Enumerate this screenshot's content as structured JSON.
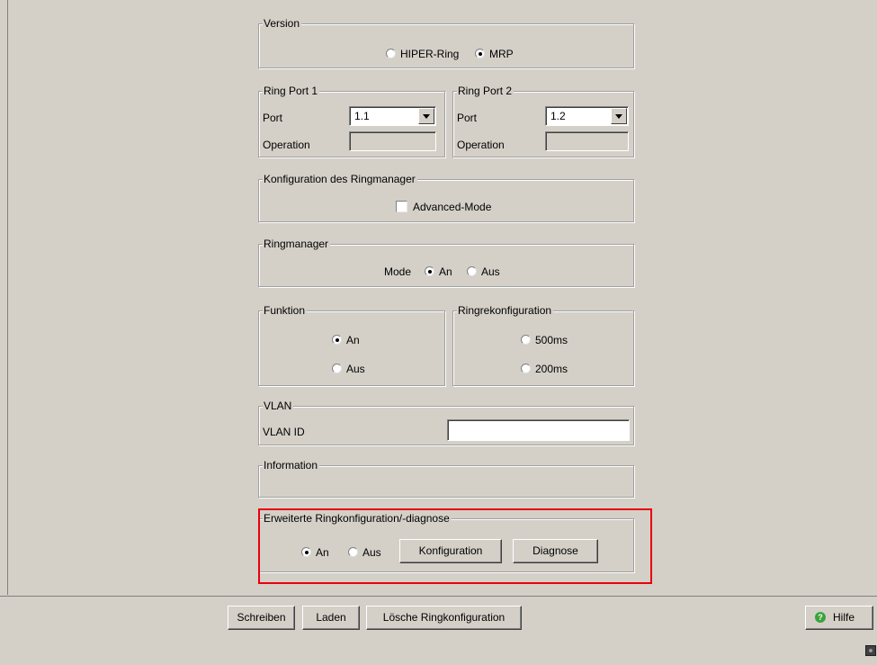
{
  "version": {
    "legend": "Version",
    "options": [
      {
        "label": "HIPER-Ring",
        "selected": false
      },
      {
        "label": "MRP",
        "selected": true
      }
    ]
  },
  "ring_port_1": {
    "legend": "Ring Port 1",
    "port_label": "Port",
    "port_value": "1.1",
    "operation_label": "Operation",
    "operation_value": ""
  },
  "ring_port_2": {
    "legend": "Ring Port 2",
    "port_label": "Port",
    "port_value": "1.2",
    "operation_label": "Operation",
    "operation_value": ""
  },
  "ringmanager_config": {
    "legend": "Konfiguration des Ringmanager",
    "advanced_mode_label": "Advanced-Mode",
    "advanced_mode_checked": false
  },
  "ringmanager": {
    "legend": "Ringmanager",
    "mode_label": "Mode",
    "options": [
      {
        "label": "An",
        "selected": true
      },
      {
        "label": "Aus",
        "selected": false
      }
    ]
  },
  "funktion": {
    "legend": "Funktion",
    "options": [
      {
        "label": "An",
        "selected": true
      },
      {
        "label": "Aus",
        "selected": false
      }
    ]
  },
  "ringrekonfiguration": {
    "legend": "Ringrekonfiguration",
    "options": [
      {
        "label": "500ms",
        "selected": false
      },
      {
        "label": "200ms",
        "selected": false
      }
    ]
  },
  "vlan": {
    "legend": "VLAN",
    "vlan_id_label": "VLAN ID",
    "vlan_id_value": ""
  },
  "information": {
    "legend": "Information"
  },
  "extended": {
    "legend": "Erweiterte Ringkonfiguration/-diagnose",
    "options": [
      {
        "label": "An",
        "selected": true
      },
      {
        "label": "Aus",
        "selected": false
      }
    ],
    "konfiguration_button": "Konfiguration",
    "diagnose_button": "Diagnose",
    "highlight_color": "#e8000c"
  },
  "bottom": {
    "schreiben": "Schreiben",
    "laden": "Laden",
    "loesche": "Lösche Ringkonfiguration",
    "hilfe": "Hilfe"
  },
  "colors": {
    "background": "#d4d0c8",
    "highlight": "#e8000c",
    "help_icon": "#3aa33a"
  }
}
